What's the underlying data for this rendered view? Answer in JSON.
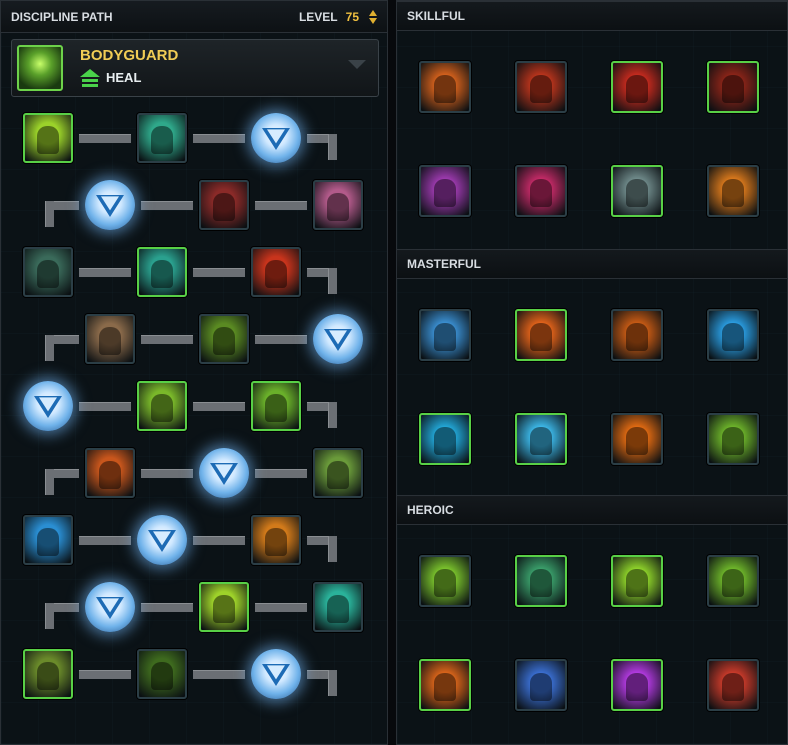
{
  "discipline_path": {
    "header_label": "DISCIPLINE PATH",
    "level_label": "LEVEL",
    "level_value": "75",
    "discipline_name": "BODYGUARD",
    "role": "HEAL",
    "rows": [
      [
        "ability-green-hand",
        "ability-teal-coil",
        "choice"
      ],
      [
        "choice",
        "ability-red-crate",
        "ability-pink-arm"
      ],
      [
        "ability-teal-gauntlet",
        "ability-teal-missile",
        "ability-red-target"
      ],
      [
        "ability-goggles-face",
        "ability-green-splat",
        "choice"
      ],
      [
        "choice",
        "ability-green-canister",
        "ability-green-shield-figure"
      ],
      [
        "ability-orange-figure",
        "choice",
        "ability-green-handshake"
      ],
      [
        "ability-blue-fountain",
        "choice",
        "ability-orange-armor"
      ],
      [
        "choice",
        "ability-green-figure",
        "ability-teal-squad"
      ],
      [
        "ability-green-droid",
        "ability-dark-silhouette",
        "choice"
      ]
    ]
  },
  "utilities": {
    "sections": [
      {
        "title": "SKILLFUL",
        "items": [
          {
            "name": "skillful-jetpack-flames",
            "active": false,
            "color": "#d2601c"
          },
          {
            "name": "skillful-flying-kick",
            "active": false,
            "color": "#b8341c"
          },
          {
            "name": "skillful-red-figure",
            "active": true,
            "color": "#c42a1e"
          },
          {
            "name": "skillful-blaster-pistol",
            "active": true,
            "color": "#8a2418"
          },
          {
            "name": "skillful-purple-blaster",
            "active": false,
            "color": "#9c3aae"
          },
          {
            "name": "skillful-pink-burst",
            "active": false,
            "color": "#c22a66"
          },
          {
            "name": "skillful-gear-icon",
            "active": true,
            "color": "#6f8a8a"
          },
          {
            "name": "skillful-orange-silhouette",
            "active": false,
            "color": "#d8781c"
          }
        ]
      },
      {
        "title": "MASTERFUL",
        "items": [
          {
            "name": "masterful-blue-dome",
            "active": false,
            "color": "#3a8ed0"
          },
          {
            "name": "masterful-orange-aura",
            "active": true,
            "color": "#e0621a"
          },
          {
            "name": "masterful-flame-shield",
            "active": false,
            "color": "#c65a14"
          },
          {
            "name": "masterful-blue-silhouette",
            "active": false,
            "color": "#2a9ce0"
          },
          {
            "name": "masterful-cyan-figure",
            "active": true,
            "color": "#22a6d6"
          },
          {
            "name": "masterful-cyan-fist",
            "active": true,
            "color": "#3cb6e6"
          },
          {
            "name": "masterful-orange-streak",
            "active": false,
            "color": "#e06a12"
          },
          {
            "name": "masterful-green-crouch",
            "active": false,
            "color": "#6cb22a"
          }
        ]
      },
      {
        "title": "HEROIC",
        "items": [
          {
            "name": "heroic-green-shield",
            "active": false,
            "color": "#7ac22c"
          },
          {
            "name": "heroic-teal-figure",
            "active": true,
            "color": "#3a9e6a"
          },
          {
            "name": "heroic-lime-figure",
            "active": true,
            "color": "#8ed22a"
          },
          {
            "name": "heroic-green-spark",
            "active": false,
            "color": "#6eb62a"
          },
          {
            "name": "heroic-orange-silhouette",
            "active": true,
            "color": "#d8641a"
          },
          {
            "name": "heroic-blue-action",
            "active": false,
            "color": "#3a6ed0"
          },
          {
            "name": "heroic-purple-silhouette",
            "active": true,
            "color": "#b23ae0"
          },
          {
            "name": "heroic-red-droid",
            "active": false,
            "color": "#c83a2a"
          }
        ]
      }
    ]
  },
  "ability_colors": {
    "ability-green-hand": "#9bd22a",
    "ability-teal-coil": "#2fa88a",
    "ability-red-crate": "#8a2a28",
    "ability-pink-arm": "#b25a8a",
    "ability-teal-gauntlet": "#3a6a5a",
    "ability-teal-missile": "#2aa08e",
    "ability-red-target": "#c8341c",
    "ability-goggles-face": "#8a6a4a",
    "ability-green-splat": "#5a8a22",
    "ability-green-canister": "#7ab82a",
    "ability-green-shield-figure": "#6ab02a",
    "ability-orange-figure": "#c8561c",
    "ability-green-handshake": "#6a9a3a",
    "ability-blue-fountain": "#2a8ed2",
    "ability-orange-armor": "#d27a1a",
    "ability-green-figure": "#9ed22a",
    "ability-teal-squad": "#2ab29a",
    "ability-green-droid": "#6a8a2a",
    "ability-dark-silhouette": "#3e6a1e"
  },
  "active_abilities": [
    "ability-green-hand",
    "ability-teal-missile",
    "ability-green-canister",
    "ability-green-shield-figure",
    "ability-green-figure",
    "ability-green-droid"
  ]
}
